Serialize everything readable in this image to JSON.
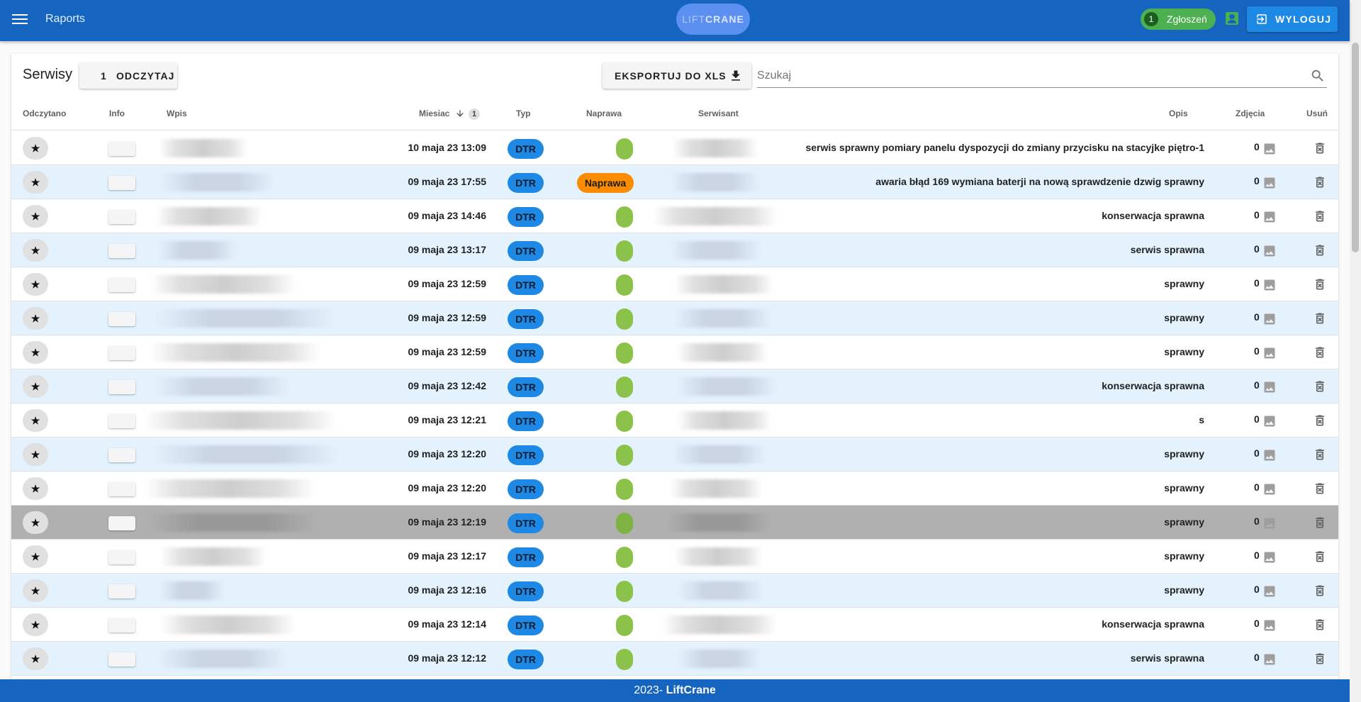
{
  "app": {
    "title": "Raports",
    "logo_part1": "LIFT",
    "logo_part2": "CRANE"
  },
  "header": {
    "notifications_count": "1",
    "notifications_label": "Zgłoszeń",
    "logout_label": "WYLOGUJ"
  },
  "toolbar": {
    "title": "Serwisy",
    "read_count": "1",
    "read_label": "ODCZYTAJ",
    "export_label": "EKSPORTUJ DO XLS",
    "search_placeholder": "Szukaj"
  },
  "table": {
    "columns": {
      "read": "Odczytano",
      "info": "Info",
      "entry": "Wpis",
      "month": "Miesiac",
      "sort_order": "1",
      "type": "Typ",
      "repair": "Naprawa",
      "technician": "Serwisant",
      "description": "Opis",
      "photos": "Zdjęcia",
      "delete": "Usuń"
    },
    "star_glyph": "★",
    "rows": [
      {
        "date": "10 maja 23 13:09",
        "type": "DTR",
        "repair": "",
        "description": "serwis sprawny pomiary panelu dyspozycji do zmiany przycisku na stacyjke piętro-1",
        "photos": "0"
      },
      {
        "date": "09 maja 23 17:55",
        "type": "DTR",
        "repair": "Naprawa",
        "description": "awaria błąd 169 wymiana baterji na nową sprawdzenie dzwig sprawny",
        "photos": "0"
      },
      {
        "date": "09 maja 23 14:46",
        "type": "DTR",
        "repair": "",
        "description": "konserwacja sprawna",
        "photos": "0"
      },
      {
        "date": "09 maja 23 13:17",
        "type": "DTR",
        "repair": "",
        "description": "serwis sprawna",
        "photos": "0"
      },
      {
        "date": "09 maja 23 12:59",
        "type": "DTR",
        "repair": "",
        "description": "sprawny",
        "photos": "0"
      },
      {
        "date": "09 maja 23 12:59",
        "type": "DTR",
        "repair": "",
        "description": "sprawny",
        "photos": "0"
      },
      {
        "date": "09 maja 23 12:59",
        "type": "DTR",
        "repair": "",
        "description": "sprawny",
        "photos": "0"
      },
      {
        "date": "09 maja 23 12:42",
        "type": "DTR",
        "repair": "",
        "description": "konserwacja sprawna",
        "photos": "0"
      },
      {
        "date": "09 maja 23 12:21",
        "type": "DTR",
        "repair": "",
        "description": "s",
        "photos": "0"
      },
      {
        "date": "09 maja 23 12:20",
        "type": "DTR",
        "repair": "",
        "description": "sprawny",
        "photos": "0"
      },
      {
        "date": "09 maja 23 12:20",
        "type": "DTR",
        "repair": "",
        "description": "sprawny",
        "photos": "0"
      },
      {
        "date": "09 maja 23 12:19",
        "type": "DTR",
        "repair": "",
        "description": "sprawny",
        "photos": "0"
      },
      {
        "date": "09 maja 23 12:17",
        "type": "DTR",
        "repair": "",
        "description": "sprawny",
        "photos": "0"
      },
      {
        "date": "09 maja 23 12:16",
        "type": "DTR",
        "repair": "",
        "description": "sprawny",
        "photos": "0"
      },
      {
        "date": "09 maja 23 12:14",
        "type": "DTR",
        "repair": "",
        "description": "konserwacja sprawna",
        "photos": "0"
      },
      {
        "date": "09 maja 23 12:12",
        "type": "DTR",
        "repair": "",
        "description": "serwis sprawna",
        "photos": "0"
      }
    ]
  },
  "footer": {
    "year": "2023- ",
    "brand": "LiftCrane"
  },
  "colors": {
    "primary": "#1565c0",
    "accent": "#1e88e5",
    "success": "#4caf50",
    "repair": "#fb8c00",
    "row_alt": "#e3f2fd",
    "row_highlight": "#b0b0b0"
  }
}
